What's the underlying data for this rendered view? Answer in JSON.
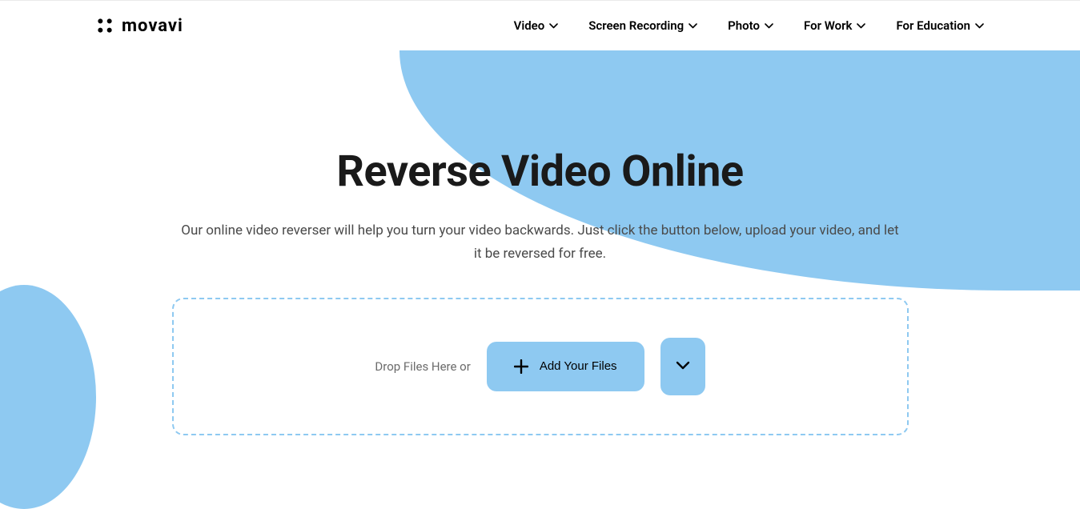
{
  "logo": {
    "text": "movavi"
  },
  "nav": {
    "items": [
      {
        "label": "Video"
      },
      {
        "label": "Screen Recording"
      },
      {
        "label": "Photo"
      },
      {
        "label": "For Work"
      },
      {
        "label": "For Education"
      }
    ]
  },
  "main": {
    "title": "Reverse Video Online",
    "subtitle": "Our online video reverser will help you turn your video backwards. Just click the button below, upload your video, and let it be reversed for free."
  },
  "dropzone": {
    "drop_label": "Drop Files Here or",
    "add_files_label": "Add Your Files"
  }
}
